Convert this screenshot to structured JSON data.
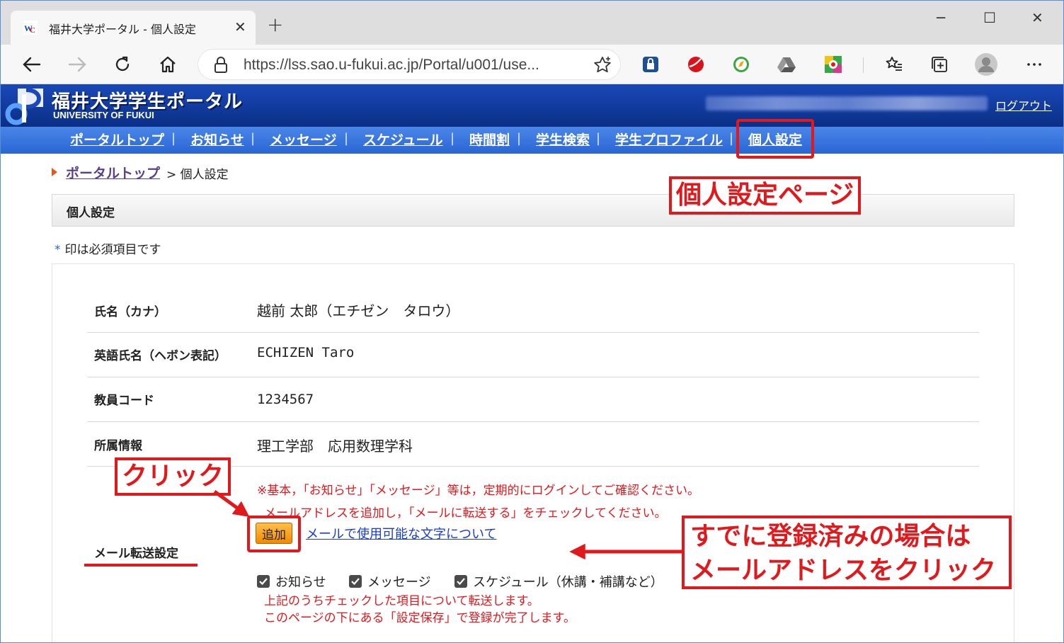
{
  "browser": {
    "tab_title": "福井大学ポータル - 個人設定",
    "tab_close": "✕",
    "new_tab": "+",
    "url": "https://lss.sao.u-fukui.ac.jp/Portal/u001/use...",
    "window_controls": {
      "minimize": "─",
      "maximize": "☐",
      "close": "✕"
    }
  },
  "portal": {
    "title": "福井大学学生ポータル",
    "subtitle": "UNIVERSITY OF FUKUI",
    "logout": "ログアウト",
    "menu": [
      "ポータルトップ",
      "お知らせ",
      "メッセージ",
      "スケジュール",
      "時間割",
      "学生検索",
      "学生プロファイル",
      "個人設定"
    ],
    "menu_separator": "|"
  },
  "breadcrumb": {
    "link": "ポータルトップ",
    "rest": "> 個人設定"
  },
  "page": {
    "section_title": "個人設定",
    "required_mark": "*",
    "required_note": "印は必須項目です"
  },
  "profile": [
    {
      "label": "氏名（カナ）",
      "value": "越前 太郎（エチゼン　タロウ）"
    },
    {
      "label": "英語氏名（ヘボン表記）",
      "value": "ECHIZEN Taro"
    },
    {
      "label": "教員コード",
      "value": "1234567"
    },
    {
      "label": "所属情報",
      "value": "理工学部　応用数理学科"
    }
  ],
  "mail": {
    "label": "メール転送設定",
    "note1": "※基本，「お知らせ」「メッセージ」等は，定期的にログインしてご確認ください。",
    "note2": "メールアドレスを追加し，「メールに転送する」をチェックしてください。",
    "add_button": "追加",
    "chars_link": "メールで使用可能な文字について",
    "checkboxes": [
      {
        "label": "お知らせ",
        "checked": true
      },
      {
        "label": "メッセージ",
        "checked": true
      },
      {
        "label": "スケジュール（休講・補講など）",
        "checked": true
      }
    ],
    "note3": "上記のうちチェックした項目について転送します。",
    "note4": "このページの下にある「設定保存」で登録が完了します。"
  },
  "annotations": {
    "page_label": "個人設定ページ",
    "click_label": "クリック",
    "registered_line1": "すでに登録済みの場合は",
    "registered_line2": "メールアドレスをクリック"
  },
  "colors": {
    "annotation_red": "#e0191c",
    "portal_blue": "#0a2f86",
    "menu_blue": "#2a66d4",
    "add_button_orange": "#f28a00"
  }
}
